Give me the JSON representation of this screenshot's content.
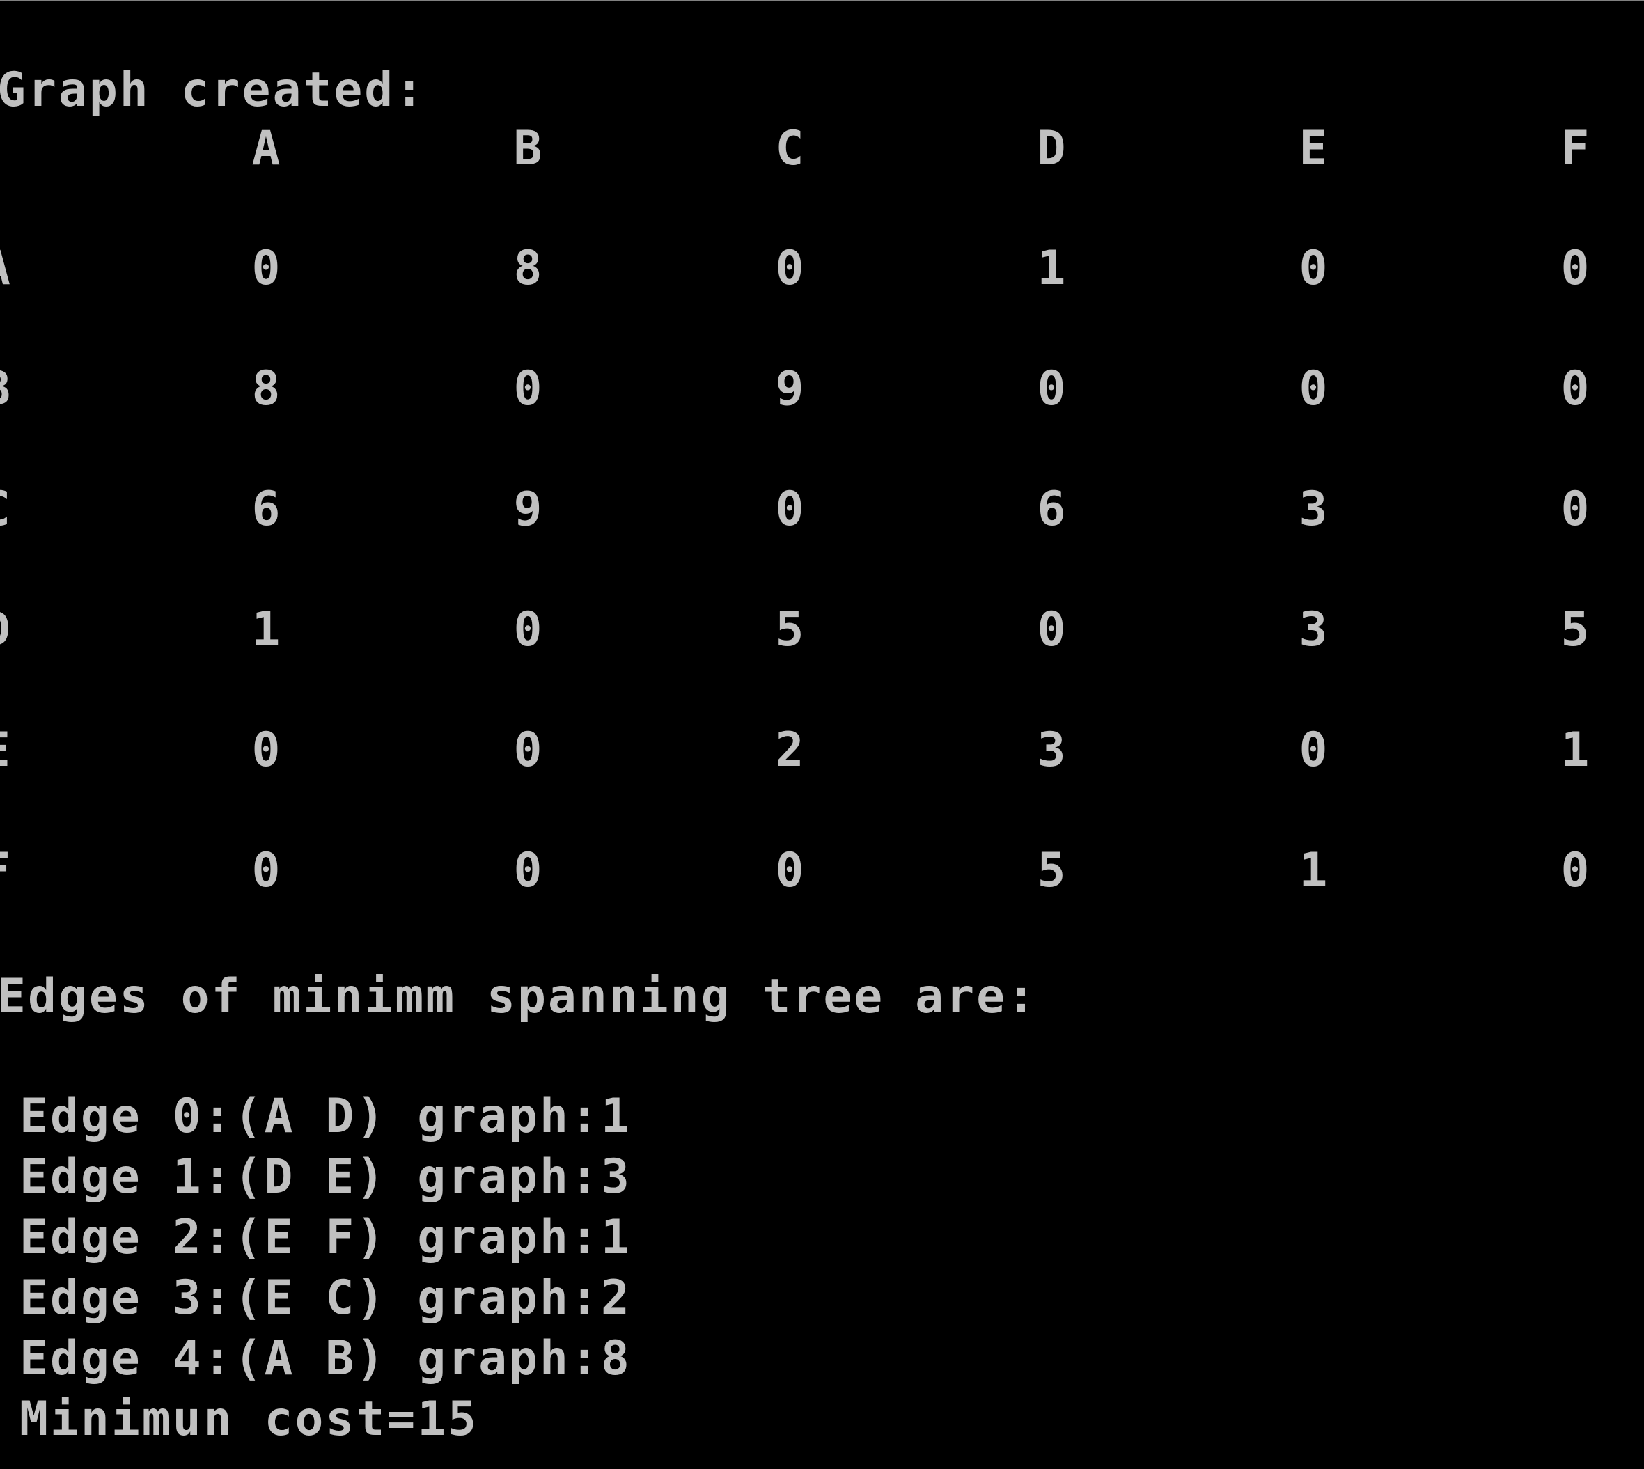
{
  "console": {
    "header": "Graph created:",
    "columns": [
      "A",
      "B",
      "C",
      "D",
      "E",
      "F"
    ],
    "rows": [
      {
        "label": "A",
        "values": [
          "0",
          "8",
          "0",
          "1",
          "0",
          "0"
        ]
      },
      {
        "label": "B",
        "values": [
          "8",
          "0",
          "9",
          "0",
          "0",
          "0"
        ]
      },
      {
        "label": "C",
        "values": [
          "6",
          "9",
          "0",
          "6",
          "3",
          "0"
        ]
      },
      {
        "label": "D",
        "values": [
          "1",
          "0",
          "5",
          "0",
          "3",
          "5"
        ]
      },
      {
        "label": "E",
        "values": [
          "0",
          "0",
          "2",
          "3",
          "0",
          "1"
        ]
      },
      {
        "label": "F",
        "values": [
          "0",
          "0",
          "0",
          "5",
          "1",
          "0"
        ]
      }
    ],
    "mst_title": "Edges of minimm spanning tree are:",
    "edges": [
      "Edge 0:(A D) graph:1",
      "Edge 1:(D E) graph:3",
      "Edge 2:(E F) graph:1",
      "Edge 3:(E C) graph:2",
      "Edge 4:(A B) graph:8"
    ],
    "cost": "Minimun cost=15"
  },
  "colors": {
    "background": "#000000",
    "text": "#c0c0c0"
  }
}
